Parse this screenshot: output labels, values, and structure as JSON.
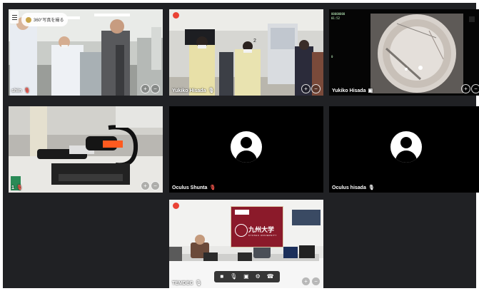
{
  "meeting": {
    "badge_360_label": "360°写真を撮る"
  },
  "tiles": [
    {
      "id": "t1",
      "participant": "shin",
      "mic_state": "muted",
      "controls": [
        "plus",
        "minus"
      ]
    },
    {
      "id": "t2",
      "participant": "Yukiko Hisada",
      "mic_state": "on",
      "controls": [
        "plus",
        "minus"
      ]
    },
    {
      "id": "t3",
      "participant": "Yukiko Hisada",
      "mic_state": "on",
      "controls": [
        "plus",
        "minus"
      ]
    },
    {
      "id": "t4",
      "participant": "1",
      "mic_state": "muted",
      "controls": [
        "plus",
        "minus"
      ]
    },
    {
      "id": "t5",
      "participant": "Oculus Shunta",
      "mic_state": "muted",
      "video": "off"
    },
    {
      "id": "t6",
      "participant": "Oculus hisada",
      "mic_state": "on",
      "video": "off"
    },
    {
      "id": "t7",
      "participant": "TEMDEC",
      "mic_state": "on",
      "controls": [
        "plus",
        "minus"
      ]
    }
  ],
  "t7_banner": {
    "title": "九州大学",
    "subtitle": "KYUSHU UNIVERSITY"
  },
  "t3_overlay_lines": [
    "00000000",
    "01:52",
    "",
    "",
    "",
    "",
    "",
    "",
    "",
    "",
    "0",
    "",
    "",
    "",
    ""
  ],
  "toolbar": {
    "buttons": [
      "camera-icon",
      "mic-icon",
      "screen-share-icon",
      "settings-icon",
      "hang-up-icon"
    ]
  },
  "colors": {
    "background": "#202124",
    "record_dot": "#ea4335",
    "muted_mic": "#ff5a4f",
    "banner": "#8b1a2a"
  }
}
